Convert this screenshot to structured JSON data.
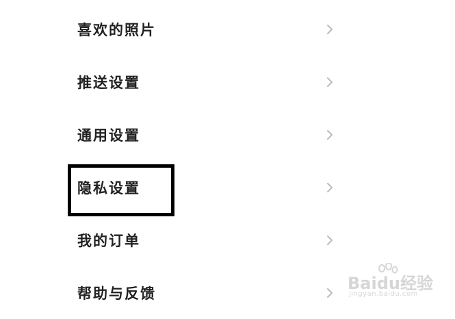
{
  "menu": {
    "items": [
      {
        "label": "喜欢的照片"
      },
      {
        "label": "推送设置"
      },
      {
        "label": "通用设置"
      },
      {
        "label": "隐私设置",
        "highlighted": true
      },
      {
        "label": "我的订单"
      },
      {
        "label": "帮助与反馈"
      }
    ]
  },
  "icons": {
    "row_chevron": "chevron-right-icon"
  },
  "colors": {
    "text": "#222222",
    "chevron": "#bbbbbb",
    "highlight_border": "#000000",
    "watermark": "#d6d6d6",
    "background": "#ffffff"
  },
  "watermark": {
    "brand": "Baidu经验",
    "url": "jingyan.baidu.com"
  }
}
